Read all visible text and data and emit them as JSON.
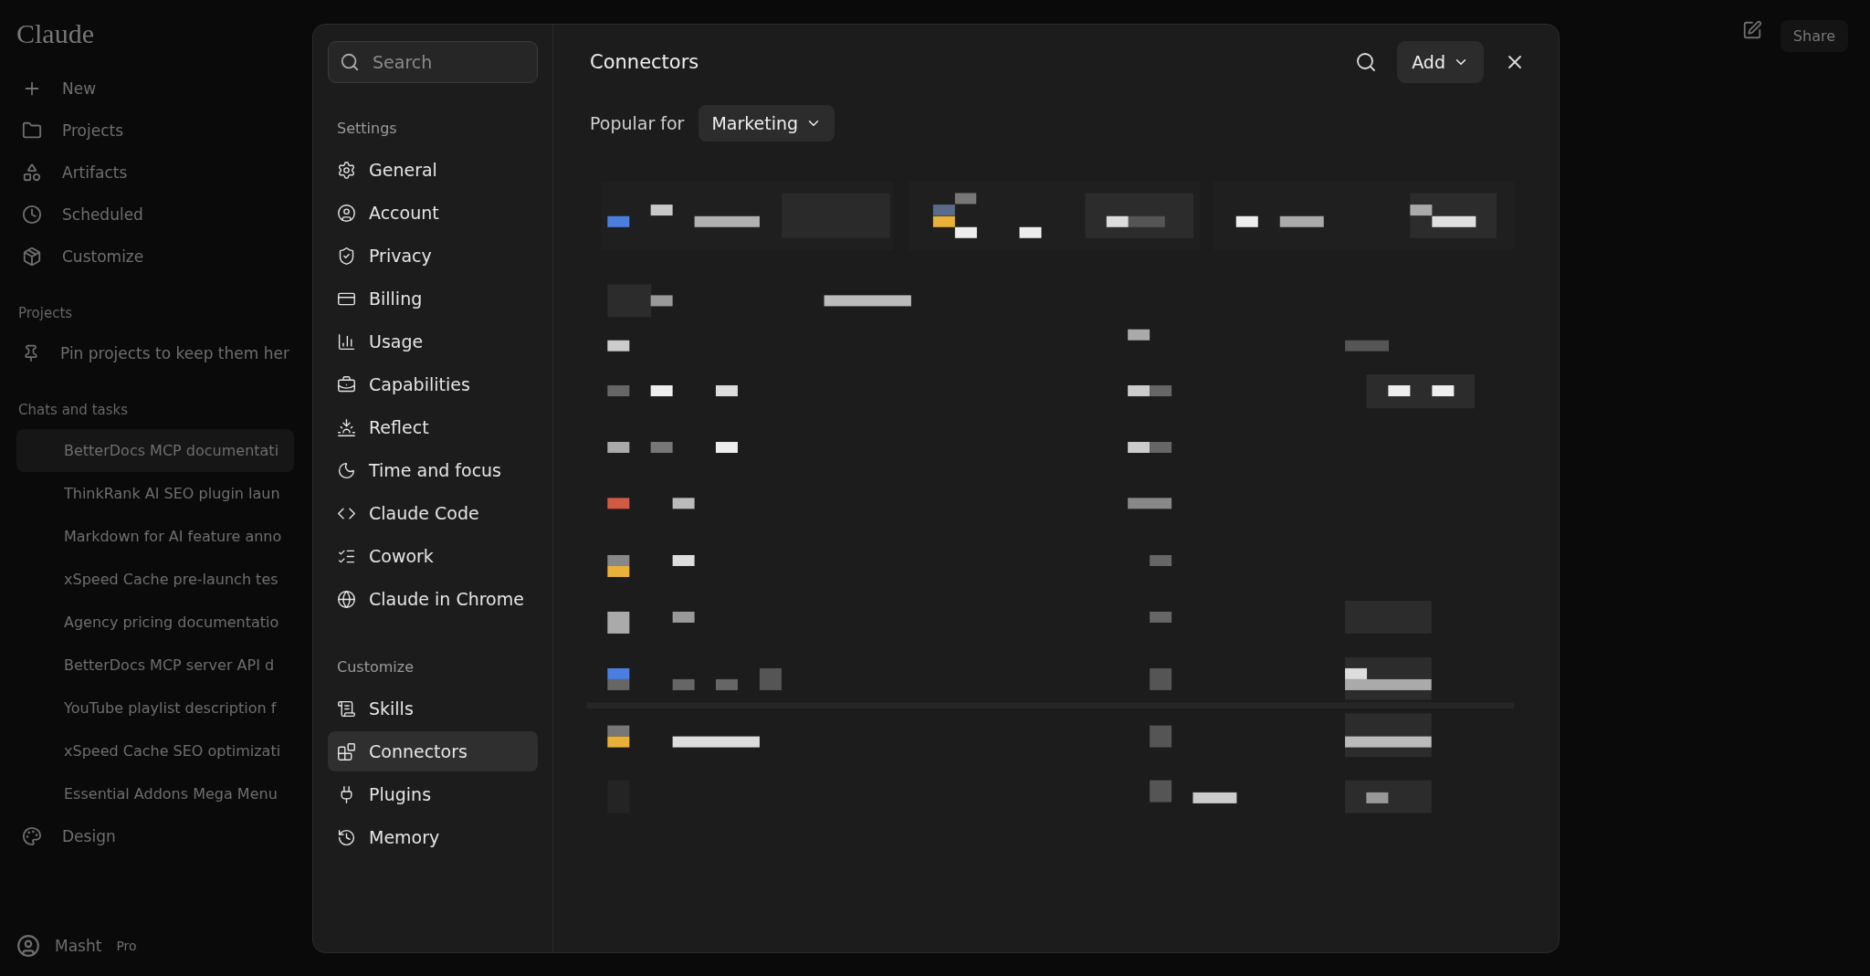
{
  "background": {
    "logo": "Claude",
    "nav": [
      "New",
      "Projects",
      "Artifacts",
      "Scheduled",
      "Customize"
    ],
    "projects_label": "Projects",
    "projects_hint": "Pin projects to keep them her",
    "chats_label": "Chats and tasks",
    "chats": [
      {
        "title": "BetterDocs MCP documentati",
        "selected": true
      },
      {
        "title": "ThinkRank AI SEO plugin laun",
        "selected": false
      },
      {
        "title": "Markdown for AI feature anno",
        "selected": false
      },
      {
        "title": "xSpeed Cache pre-launch tes",
        "selected": false
      },
      {
        "title": "Agency pricing documentatio",
        "selected": false
      },
      {
        "title": "BetterDocs MCP server API d",
        "selected": false
      },
      {
        "title": "YouTube playlist description f",
        "selected": false
      },
      {
        "title": "xSpeed Cache SEO optimizati",
        "selected": false
      },
      {
        "title": "Essential Addons Mega Menu",
        "selected": false
      }
    ],
    "design": "Design",
    "user": "Masht",
    "plan": "Pro",
    "share": "Share"
  },
  "settings": {
    "search": {
      "placeholder": "Search"
    },
    "sections": [
      {
        "label": "Settings",
        "items": [
          {
            "label": "General",
            "selected": false
          },
          {
            "label": "Account",
            "selected": false
          },
          {
            "label": "Privacy",
            "selected": false
          },
          {
            "label": "Billing",
            "selected": false
          },
          {
            "label": "Usage",
            "selected": false
          },
          {
            "label": "Capabilities",
            "selected": false
          },
          {
            "label": "Reflect",
            "selected": false
          },
          {
            "label": "Time and focus",
            "selected": false
          },
          {
            "label": "Claude Code",
            "selected": false
          },
          {
            "label": "Cowork",
            "selected": false
          },
          {
            "label": "Claude in Chrome",
            "selected": false
          }
        ]
      },
      {
        "label": "Customize",
        "items": [
          {
            "label": "Skills",
            "selected": false
          },
          {
            "label": "Connectors",
            "selected": true
          },
          {
            "label": "Plugins",
            "selected": false
          },
          {
            "label": "Memory",
            "selected": false
          }
        ]
      }
    ]
  },
  "panel": {
    "title": "Connectors",
    "add_button": "Add",
    "filter_label": "Popular for",
    "filter_value": "Marketing"
  }
}
